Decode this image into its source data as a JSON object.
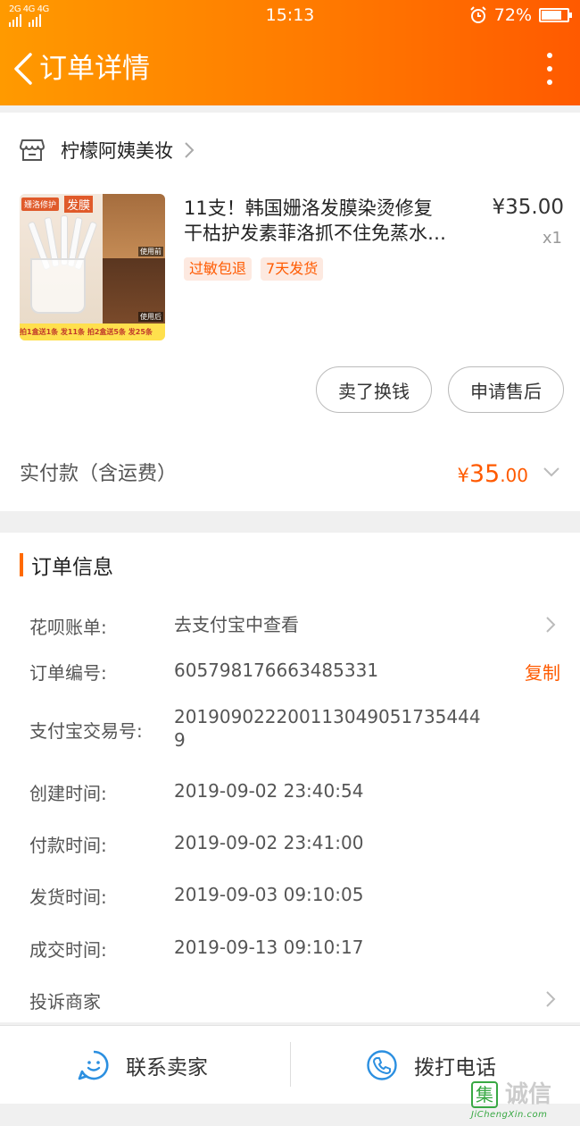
{
  "status_bar": {
    "signal": "2G 4G 4G",
    "time": "15:13",
    "battery": "72%"
  },
  "nav": {
    "title": "订单详情"
  },
  "shop": {
    "name": "柠檬阿姨美妆"
  },
  "product": {
    "title_line1": "11支！韩国姗洛发膜染烫修复",
    "title_line2": "干枯护发素菲洛抓不住免蒸水…",
    "price": "¥35.00",
    "quantity": "x1",
    "tags": [
      "过敏包退",
      "7天发货"
    ],
    "image": {
      "brand_tag": "姗洛修护",
      "product_tag": "发膜",
      "caption_before": "使用前",
      "caption_after": "使用后",
      "promo": "拍1盒送1条 发11条  拍2盒送5条 发25条"
    }
  },
  "actions": {
    "sell_label": "卖了换钱",
    "after_sale_label": "申请售后"
  },
  "payment": {
    "label": "实付款（含运费）",
    "currency": "¥",
    "amount_int": "35",
    "amount_dec": ".00"
  },
  "order_info": {
    "title": "订单信息",
    "huabei_label": "花呗账单:",
    "huabei_value": "去支付宝中查看",
    "order_no_label": "订单编号:",
    "order_no_value": "605798176663485331",
    "copy_label": "复制",
    "alipay_label": "支付宝交易号:",
    "alipay_value": "2019090222001130490517354449",
    "created_label": "创建时间:",
    "created_value": "2019-09-02 23:40:54",
    "paid_label": "付款时间:",
    "paid_value": "2019-09-02 23:41:00",
    "shipped_label": "发货时间:",
    "shipped_value": "2019-09-03 09:10:05",
    "completed_label": "成交时间:",
    "completed_value": "2019-09-13 09:10:17",
    "complaint_label": "投诉商家"
  },
  "bottom_bar": {
    "contact_label": "联系卖家",
    "call_label": "拨打电话"
  },
  "watermark": {
    "logo": "集",
    "text": "诚信",
    "url": "JiChengXin.com"
  },
  "colors": {
    "accent": "#ff5a00",
    "header_start": "#ff9a00",
    "header_end": "#ff5a00",
    "icon_blue": "#2b8fe0"
  }
}
